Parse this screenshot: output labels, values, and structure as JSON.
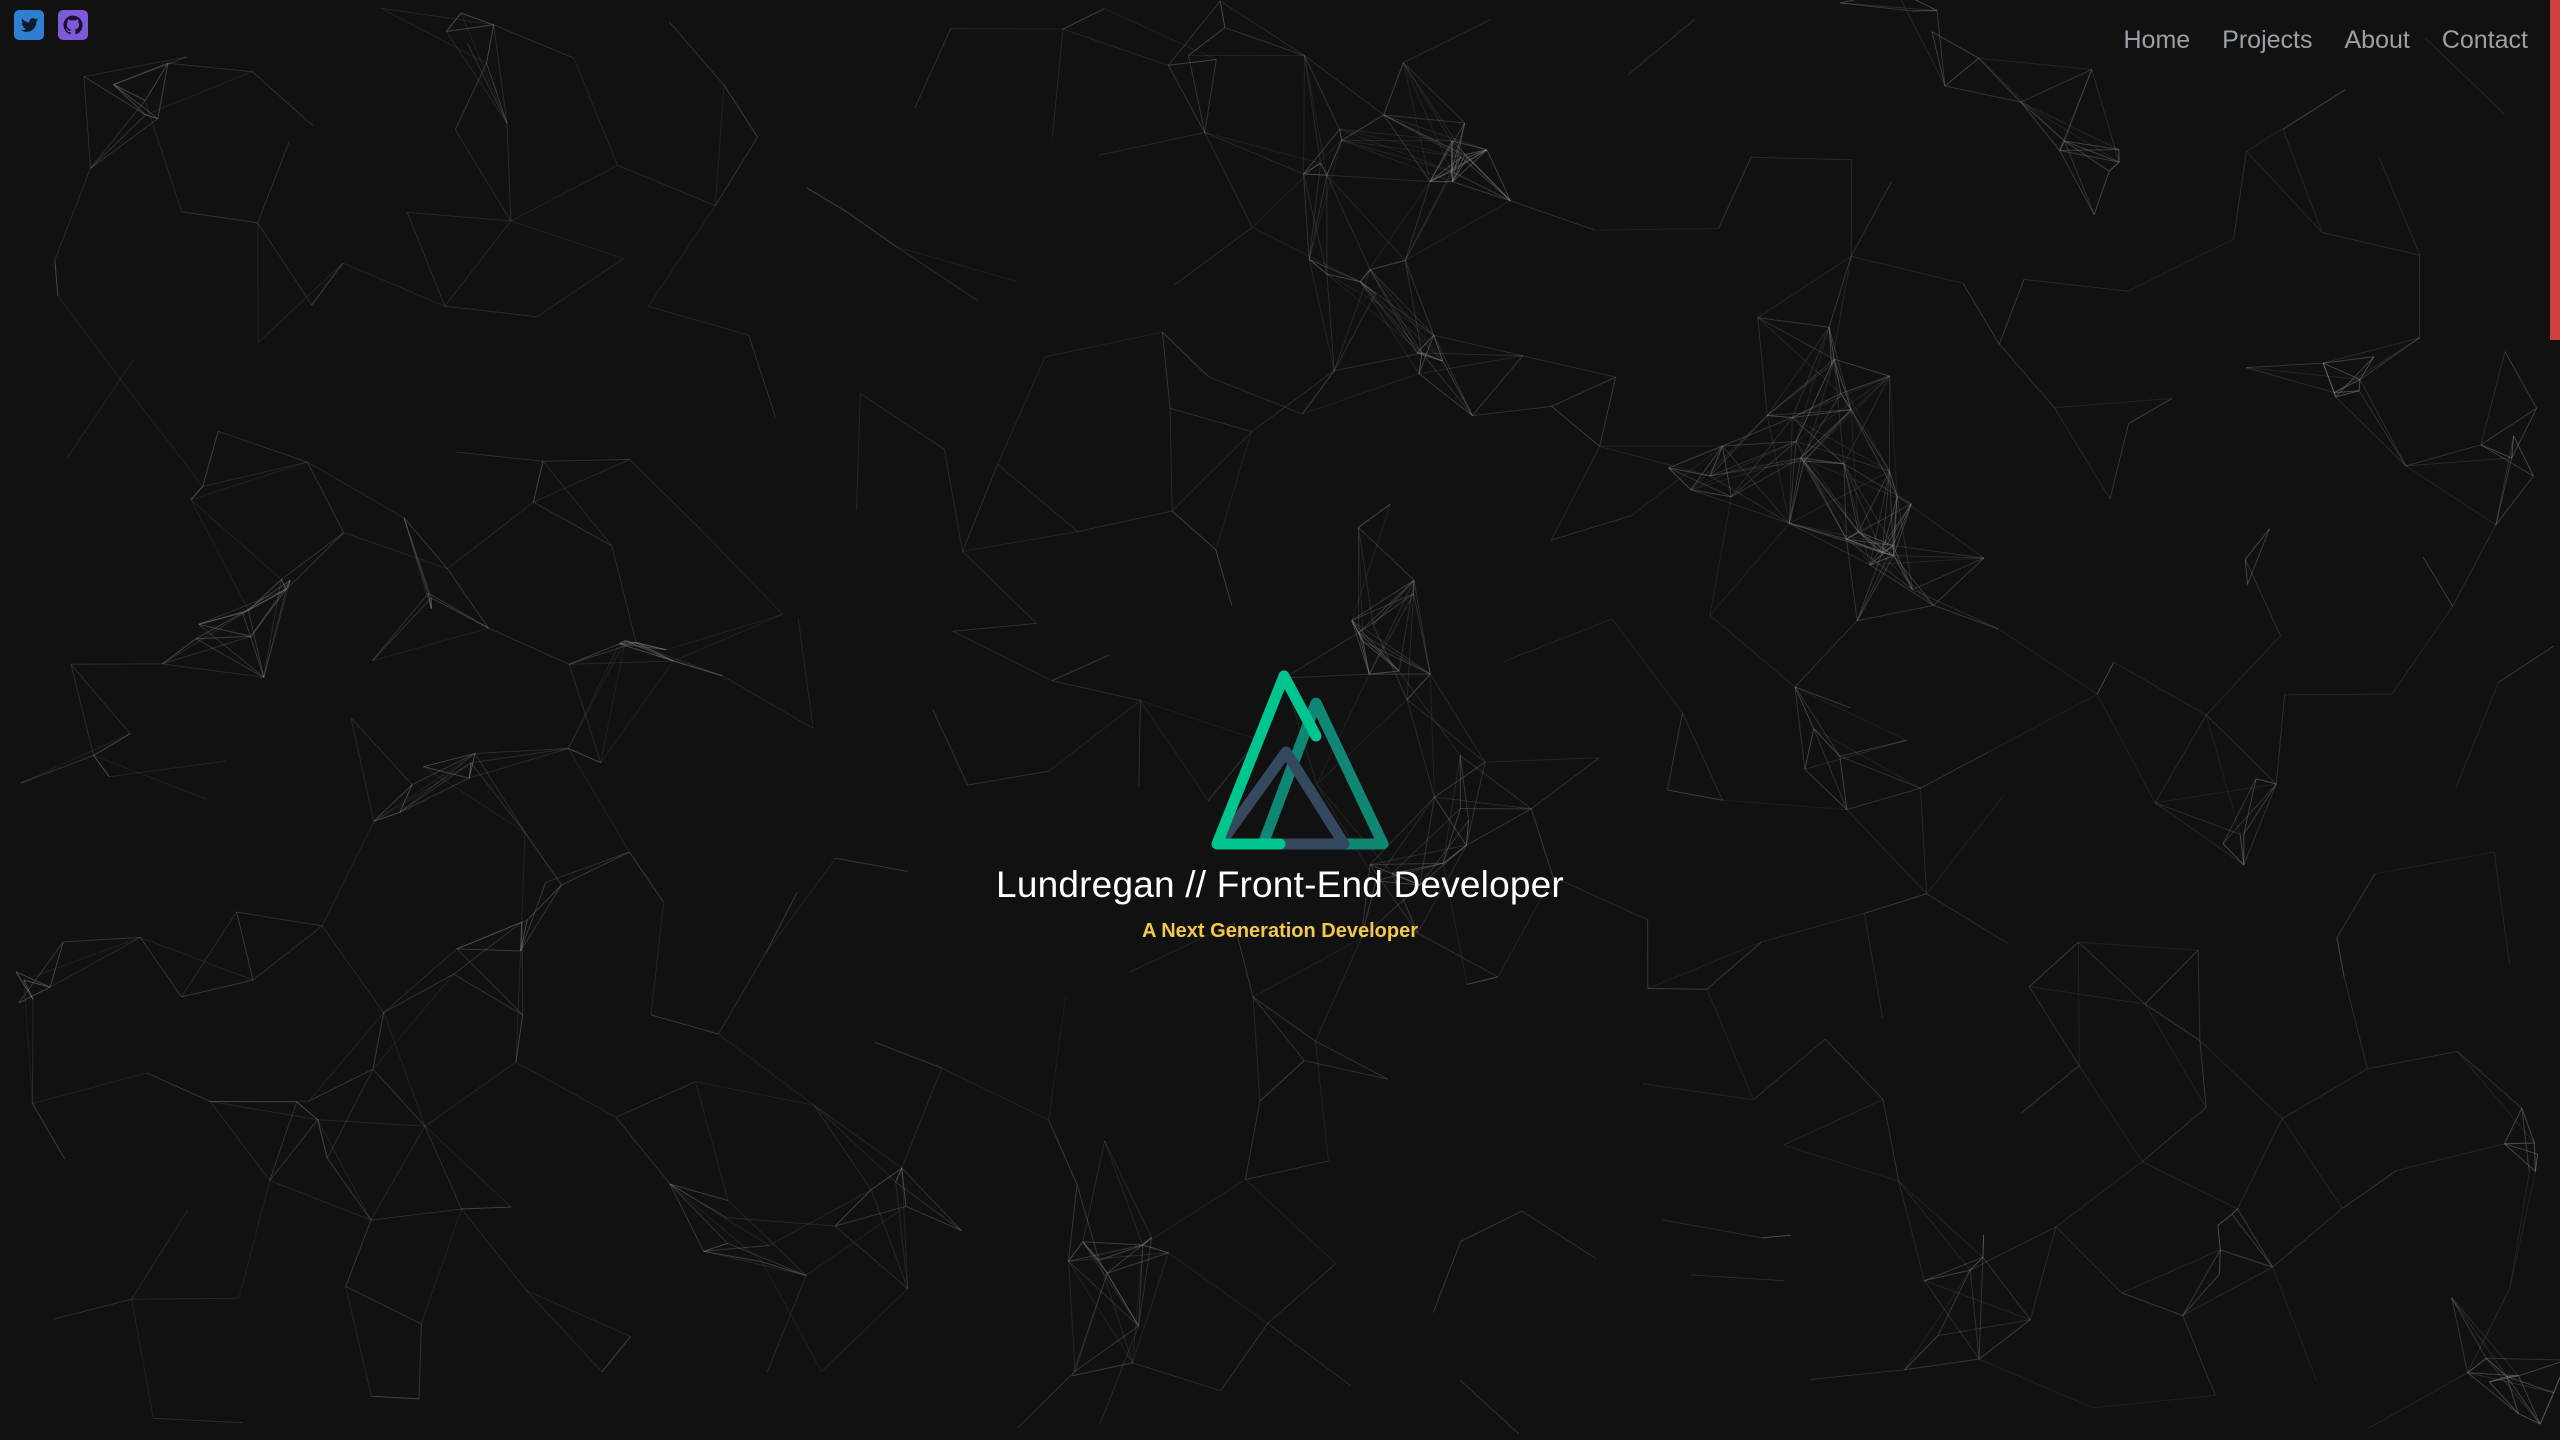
{
  "social": {
    "twitter_icon": "twitter-icon",
    "github_icon": "github-icon",
    "twitter_color": "#2f7fd1",
    "github_color": "#7e5ad8"
  },
  "nav": {
    "items": [
      {
        "label": "Home"
      },
      {
        "label": "Projects"
      },
      {
        "label": "About"
      },
      {
        "label": "Contact"
      }
    ]
  },
  "hero": {
    "logo_icon": "nuxt-mountain-logo",
    "logo_green": "#00c58e",
    "logo_teal": "#108775",
    "logo_slate": "#35495e",
    "title": "Lundregan // Front-End Developer",
    "subtitle": "A Next Generation Developer",
    "subtitle_color": "#f2c94c"
  },
  "theme": {
    "background": "#111111",
    "network_line_color": "#8a8a8a",
    "scroll_indicator_color": "#d0403e"
  }
}
